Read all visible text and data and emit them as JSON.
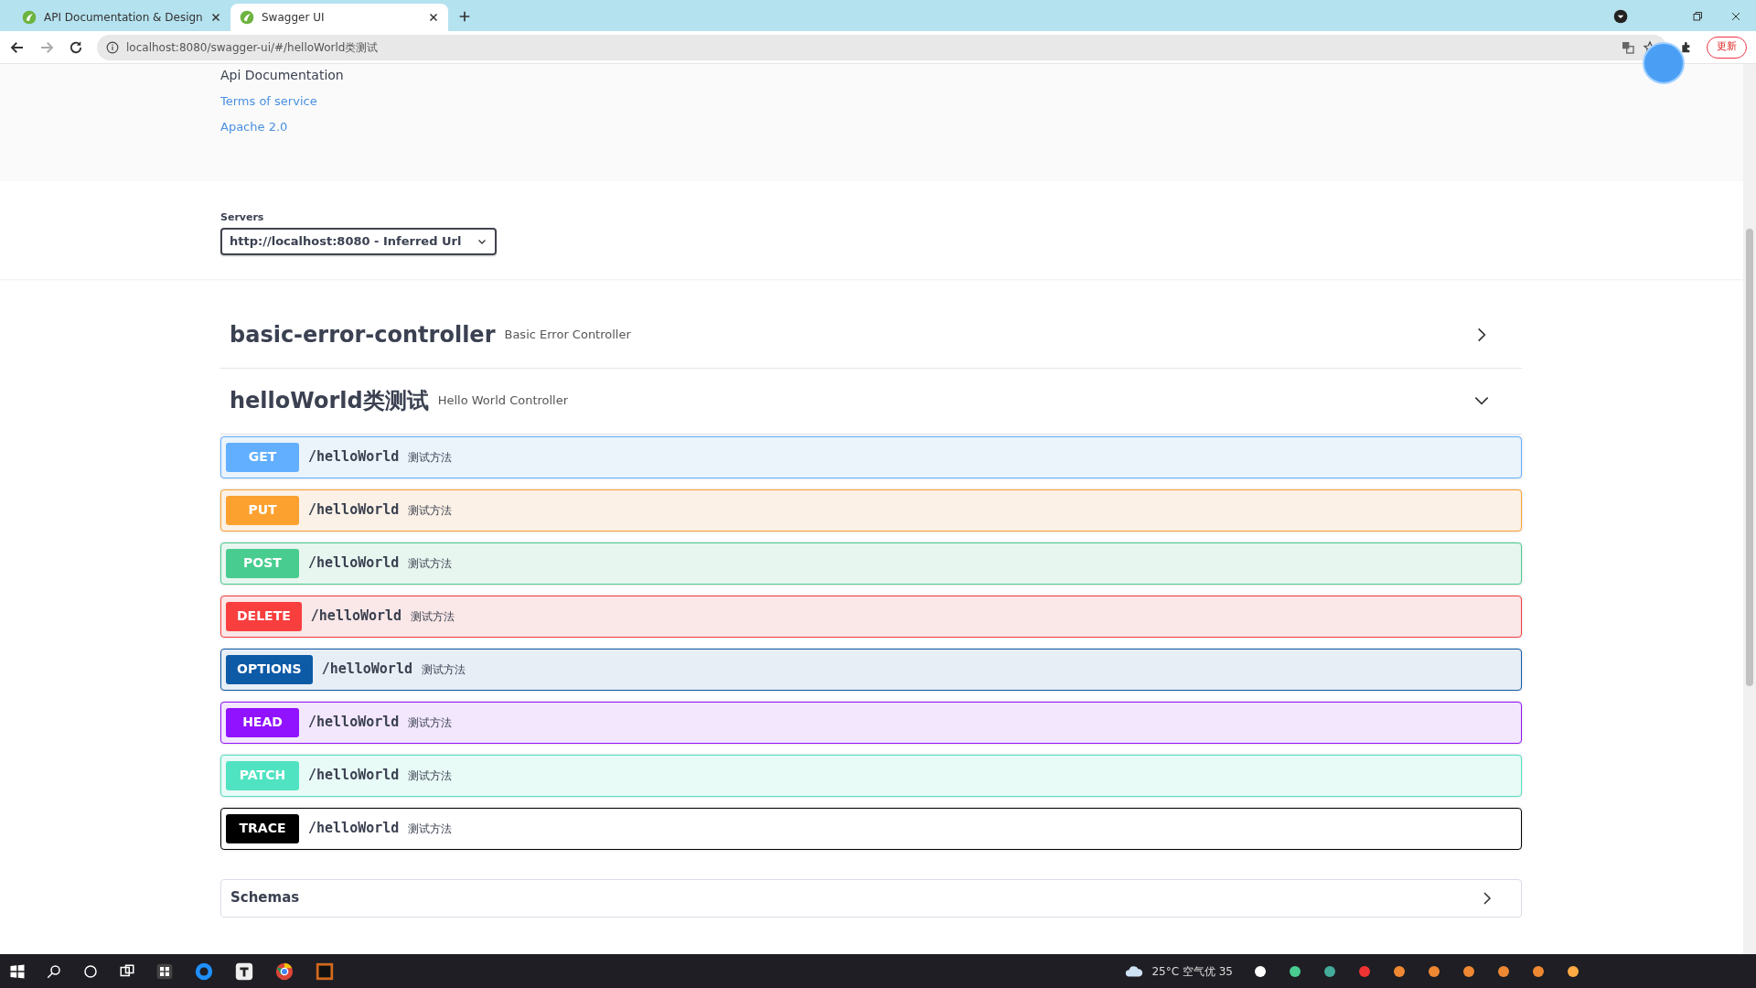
{
  "browser": {
    "tabs": [
      {
        "title": "API Documentation & Design",
        "selected": false
      },
      {
        "title": "Swagger UI",
        "selected": true
      }
    ],
    "url": "localhost:8080/swagger-ui/#/helloWorld类测试",
    "update_label": "更新"
  },
  "info": {
    "description": "Api Documentation",
    "links": [
      "Terms of service",
      "Apache 2.0"
    ]
  },
  "servers": {
    "label": "Servers",
    "value": "http://localhost:8080 - Inferred Url"
  },
  "controllers": [
    {
      "name": "basic-error-controller",
      "description": "Basic Error Controller",
      "expanded": false
    },
    {
      "name": "helloWorld类测试",
      "description": "Hello World Controller",
      "expanded": true,
      "operations": [
        {
          "method": "GET",
          "path": "/helloWorld",
          "summary": "测试方法"
        },
        {
          "method": "PUT",
          "path": "/helloWorld",
          "summary": "测试方法"
        },
        {
          "method": "POST",
          "path": "/helloWorld",
          "summary": "测试方法"
        },
        {
          "method": "DELETE",
          "path": "/helloWorld",
          "summary": "测试方法"
        },
        {
          "method": "OPTIONS",
          "path": "/helloWorld",
          "summary": "测试方法"
        },
        {
          "method": "HEAD",
          "path": "/helloWorld",
          "summary": "测试方法"
        },
        {
          "method": "PATCH",
          "path": "/helloWorld",
          "summary": "测试方法"
        },
        {
          "method": "TRACE",
          "path": "/helloWorld",
          "summary": "测试方法"
        }
      ]
    }
  ],
  "schemas": {
    "title": "Schemas"
  },
  "taskbar": {
    "weather": "25°C 空气优 35"
  }
}
